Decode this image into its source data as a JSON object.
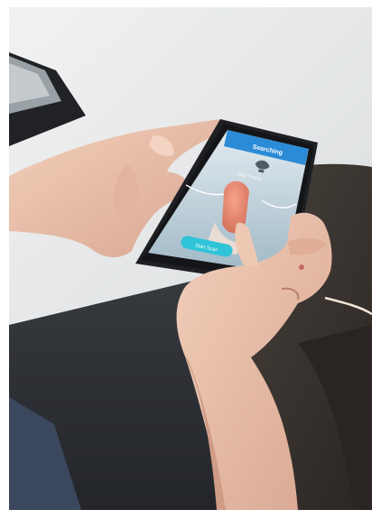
{
  "photo": {
    "subject": "hands-holding-smartphone",
    "colors": {
      "wall": "#e9ebeb",
      "floor": "#2c2e33",
      "jeans": "#39465a",
      "jacket": "#3a3632",
      "skin": "#ecc4ae",
      "skin_shadow": "#cf9c86",
      "phone_body": "#1e2024"
    }
  },
  "app": {
    "header_title": "Searching",
    "hint_text": "Align Thumb",
    "action_label": "Start Scan",
    "colors": {
      "header": "#2c8bd6",
      "screen_bg": "#b8cbd6",
      "button": "#2fc4d8"
    }
  }
}
